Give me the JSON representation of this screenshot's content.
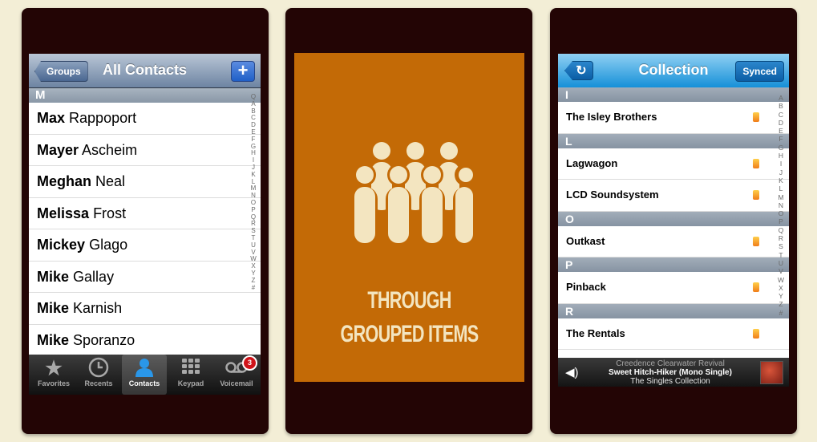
{
  "contacts_app": {
    "back_button": "Groups",
    "title": "All Contacts",
    "add_button": "+",
    "section_header": "M",
    "contacts": [
      {
        "first": "Max",
        "last": "Rappoport"
      },
      {
        "first": "Mayer",
        "last": "Ascheim"
      },
      {
        "first": "Meghan",
        "last": "Neal"
      },
      {
        "first": "Melissa",
        "last": "Frost"
      },
      {
        "first": "Mickey",
        "last": "Glago"
      },
      {
        "first": "Mike",
        "last": "Gallay"
      },
      {
        "first": "Mike",
        "last": "Karnish"
      },
      {
        "first": "Mike",
        "last": "Sporanzo"
      }
    ],
    "index": [
      "Q",
      "A",
      "B",
      "C",
      "D",
      "E",
      "F",
      "G",
      "H",
      "I",
      "J",
      "K",
      "L",
      "M",
      "N",
      "O",
      "P",
      "Q",
      "R",
      "S",
      "T",
      "U",
      "V",
      "W",
      "X",
      "Y",
      "Z",
      "#"
    ],
    "tabs": [
      {
        "label": "Favorites",
        "icon": "star-icon"
      },
      {
        "label": "Recents",
        "icon": "clock-icon"
      },
      {
        "label": "Contacts",
        "icon": "person-icon",
        "active": true
      },
      {
        "label": "Keypad",
        "icon": "keypad-icon"
      },
      {
        "label": "Voicemail",
        "icon": "voicemail-icon",
        "badge": "3"
      }
    ]
  },
  "middle_card": {
    "line1": "THROUGH",
    "line2": "GROUPED ITEMS",
    "icon": "group-people-icon",
    "background": "#c36a06",
    "foreground": "#f3e5c0"
  },
  "collection_app": {
    "back_icon": "refresh-icon",
    "title": "Collection",
    "synced_button": "Synced",
    "sections": [
      {
        "header": "I",
        "items": [
          "The Isley Brothers"
        ]
      },
      {
        "header": "L",
        "items": [
          "Lagwagon",
          "LCD Soundsystem"
        ]
      },
      {
        "header": "O",
        "items": [
          "Outkast"
        ]
      },
      {
        "header": "P",
        "items": [
          "Pinback"
        ]
      },
      {
        "header": "R",
        "items": [
          "The Rentals"
        ]
      }
    ],
    "index": [
      "A",
      "B",
      "C",
      "D",
      "E",
      "F",
      "G",
      "H",
      "I",
      "J",
      "K",
      "L",
      "M",
      "N",
      "O",
      "P",
      "Q",
      "R",
      "S",
      "T",
      "U",
      "V",
      "W",
      "X",
      "Y",
      "Z",
      "#"
    ],
    "now_playing": {
      "artist": "Creedence Clearwater Revival",
      "song": "Sweet Hitch-Hiker (Mono Single)",
      "album": "The Singles Collection"
    }
  },
  "colors": {
    "background": "#f3eed6",
    "panel": "#230505",
    "accent_blue": "#1690d8"
  }
}
